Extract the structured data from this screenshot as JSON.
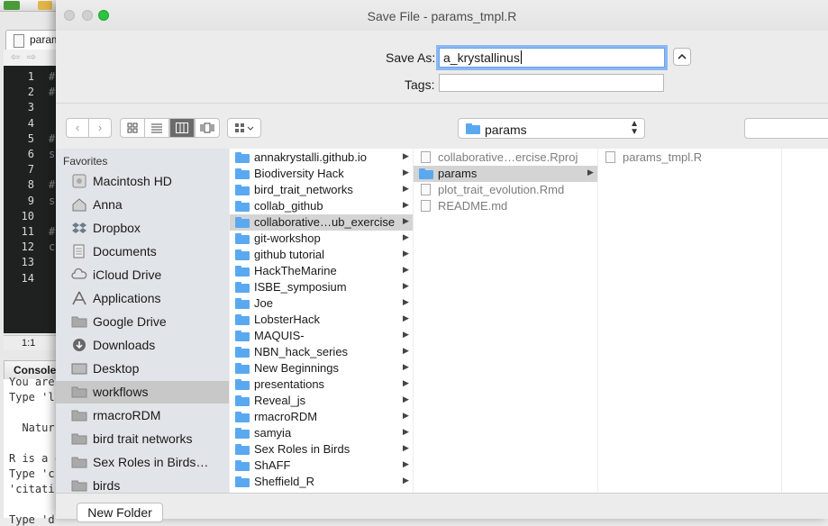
{
  "background_app": {
    "editor_tab": "param",
    "line_numbers": [
      "1",
      "2",
      "3",
      "4",
      "5",
      "6",
      "7",
      "8",
      "9",
      "10",
      "11",
      "12",
      "13",
      "14"
    ],
    "code_prefixes": [
      "#",
      "#",
      "",
      "",
      "#",
      "s",
      "",
      "#",
      "s",
      "",
      "#",
      "c",
      "",
      ""
    ],
    "cursor_pos": "1:1",
    "console_title": "Console",
    "console_lines": [
      "You are",
      "Type 'l",
      "",
      "  Natur",
      "",
      "R is a c",
      "Type 'c",
      "'citati",
      "",
      "Type 'd"
    ]
  },
  "dialog": {
    "title": "Save File - params_tmpl.R",
    "save_as_label": "Save As:",
    "save_as_value": "a_krystallinus",
    "tags_label": "Tags:",
    "tags_value": "",
    "expand_icon": "chevron-up-icon",
    "location": "params",
    "new_folder_label": "New Folder"
  },
  "toolbar": {
    "back_icon": "‹",
    "forward_icon": "›",
    "view_icons": [
      "icon-view",
      "list-view",
      "column-view",
      "cover-flow-view"
    ],
    "arrange_icon": "arrange-icon"
  },
  "sidebar": {
    "heading": "Favorites",
    "items": [
      {
        "label": "Macintosh HD",
        "icon": "hard-drive-icon"
      },
      {
        "label": "Anna",
        "icon": "home-icon"
      },
      {
        "label": "Dropbox",
        "icon": "dropbox-icon"
      },
      {
        "label": "Documents",
        "icon": "documents-icon"
      },
      {
        "label": "iCloud Drive",
        "icon": "cloud-icon"
      },
      {
        "label": "Applications",
        "icon": "applications-icon"
      },
      {
        "label": "Google Drive",
        "icon": "folder-icon"
      },
      {
        "label": "Downloads",
        "icon": "downloads-icon"
      },
      {
        "label": "Desktop",
        "icon": "desktop-icon"
      },
      {
        "label": "workflows",
        "icon": "folder-icon",
        "selected": true
      },
      {
        "label": "rmacroRDM",
        "icon": "folder-icon"
      },
      {
        "label": "bird trait networks",
        "icon": "folder-icon"
      },
      {
        "label": "Sex Roles in Birds…",
        "icon": "folder-icon"
      },
      {
        "label": "birds",
        "icon": "folder-icon"
      }
    ]
  },
  "column1": [
    {
      "name": "annakrystalli.github.io"
    },
    {
      "name": "Biodiversity Hack"
    },
    {
      "name": "bird_trait_networks"
    },
    {
      "name": "collab_github"
    },
    {
      "name": "collaborative…ub_exercise",
      "selected": true
    },
    {
      "name": "git-workshop"
    },
    {
      "name": "github tutorial"
    },
    {
      "name": "HackTheMarine"
    },
    {
      "name": "ISBE_symposium"
    },
    {
      "name": "Joe"
    },
    {
      "name": "LobsterHack"
    },
    {
      "name": "MAQUIS-"
    },
    {
      "name": "NBN_hack_series"
    },
    {
      "name": "New Beginnings"
    },
    {
      "name": "presentations"
    },
    {
      "name": "Reveal_js"
    },
    {
      "name": "rmacroRDM"
    },
    {
      "name": "samyia"
    },
    {
      "name": "Sex Roles in Birds"
    },
    {
      "name": "ShAFF"
    },
    {
      "name": "Sheffield_R"
    }
  ],
  "column2": [
    {
      "name": "collaborative…ercise.Rproj",
      "kind": "file"
    },
    {
      "name": "params",
      "kind": "folder",
      "selected": true
    },
    {
      "name": "plot_trait_evolution.Rmd",
      "kind": "file"
    },
    {
      "name": "README.md",
      "kind": "file"
    }
  ],
  "column3": [
    {
      "name": "params_tmpl.R",
      "kind": "file"
    }
  ]
}
